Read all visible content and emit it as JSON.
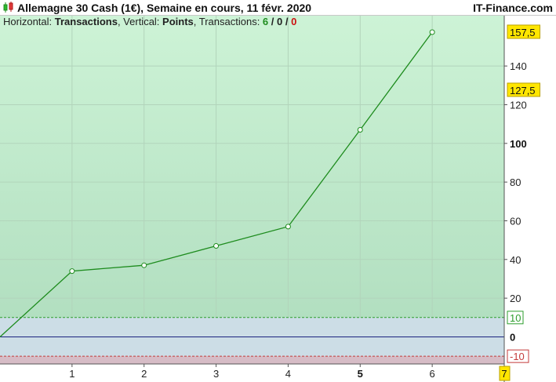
{
  "header": {
    "title": "Allemagne 30 Cash (1€), Semaine en cours, 11 févr. 2020",
    "brand": "IT-Finance.com"
  },
  "info": {
    "horizontal_label": "Horizontal: ",
    "horizontal_value": "Transactions",
    "vertical_label": ", Vertical: ",
    "vertical_value": "Points",
    "transactions_label": ", Transactions: ",
    "wins": "6",
    "sep1": " / ",
    "neutral": "0",
    "sep2": " / ",
    "losses": "0"
  },
  "colors": {
    "line": "#1e8c1e",
    "zero_line": "#1a237e",
    "band_upper": "#2e9e2e",
    "band_lower": "#c43b3b",
    "highlight": "#ffe600"
  },
  "chart_data": {
    "type": "line",
    "x": [
      0,
      1,
      2,
      3,
      4,
      5,
      6
    ],
    "series": [
      {
        "values": [
          0,
          34,
          37,
          47,
          57,
          107,
          157.5
        ]
      }
    ],
    "xlim": [
      0,
      7
    ],
    "ylim": [
      -14,
      166
    ],
    "x_ticks": [
      "1",
      "2",
      "3",
      "4",
      "5",
      "6",
      "7"
    ],
    "x_tick_values": [
      1,
      2,
      3,
      4,
      5,
      6,
      7
    ],
    "x_bold_tick": "5",
    "x_highlight_tick": "7",
    "y_ticks": [
      "20",
      "40",
      "60",
      "80",
      "100",
      "120",
      "140"
    ],
    "y_tick_values": [
      20,
      40,
      60,
      80,
      100,
      120,
      140
    ],
    "y_bold_ticks": [
      "0",
      "100"
    ],
    "zero_label": "0",
    "upper_band": {
      "value": 10,
      "label": "10"
    },
    "lower_band": {
      "value": -10,
      "label": "-10"
    },
    "markers": [
      {
        "value": 157.5,
        "label": "157,5"
      },
      {
        "value": 127.5,
        "label": "127,5"
      }
    ],
    "grid": true
  }
}
